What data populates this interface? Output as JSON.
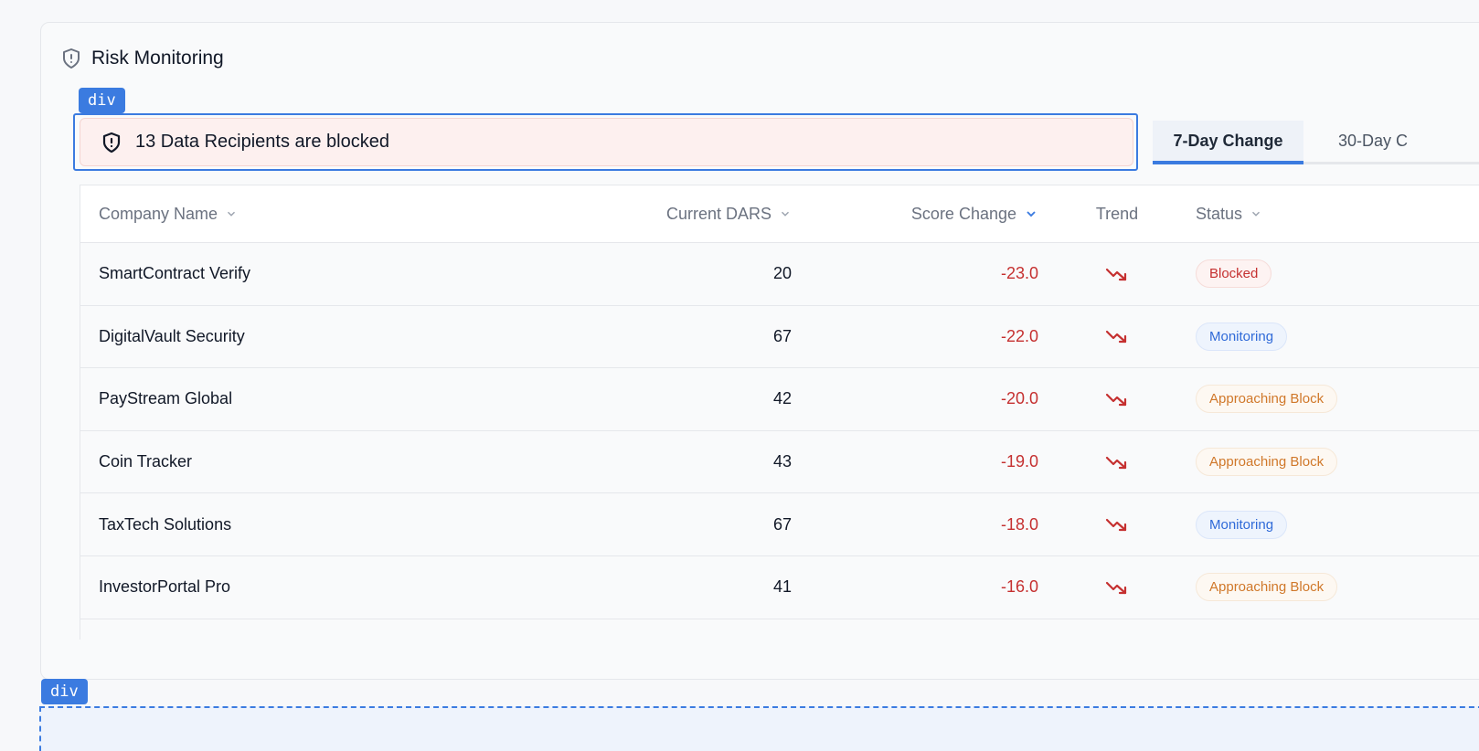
{
  "card": {
    "title": "Risk Monitoring"
  },
  "dev_tags": {
    "alert_tag": "div",
    "bottom_tag": "div"
  },
  "alert": {
    "text": "13 Data Recipients are blocked"
  },
  "tabs": [
    {
      "label": "7-Day Change",
      "active": true
    },
    {
      "label": "30-Day C",
      "active": false
    }
  ],
  "table": {
    "columns": {
      "company": "Company Name",
      "dars": "Current DARS",
      "change": "Score Change",
      "trend": "Trend",
      "status": "Status"
    },
    "rows": [
      {
        "company": "SmartContract Verify",
        "dars": "20",
        "change": "-23.0",
        "status": "Blocked"
      },
      {
        "company": "DigitalVault Security",
        "dars": "67",
        "change": "-22.0",
        "status": "Monitoring"
      },
      {
        "company": "PayStream Global",
        "dars": "42",
        "change": "-20.0",
        "status": "Approaching Block"
      },
      {
        "company": "Coin Tracker",
        "dars": "43",
        "change": "-19.0",
        "status": "Approaching Block"
      },
      {
        "company": "TaxTech Solutions",
        "dars": "67",
        "change": "-18.0",
        "status": "Monitoring"
      },
      {
        "company": "InvestorPortal Pro",
        "dars": "41",
        "change": "-16.0",
        "status": "Approaching Block"
      }
    ]
  },
  "colors": {
    "accent": "#3b7be0",
    "negative": "#c53030",
    "monitoring": "#2f6ad8",
    "approaching": "#d0782a"
  }
}
